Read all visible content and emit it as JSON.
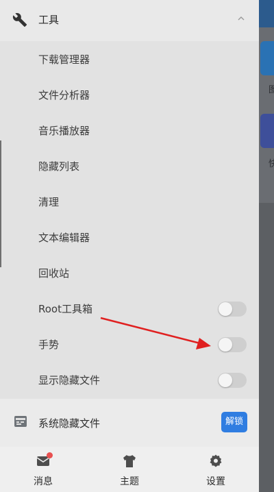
{
  "background": {
    "tile_labels": [
      "图",
      "快"
    ]
  },
  "drawer": {
    "section_title": "工具",
    "items": [
      {
        "label": "下载管理器"
      },
      {
        "label": "文件分析器"
      },
      {
        "label": "音乐播放器"
      },
      {
        "label": "隐藏列表"
      },
      {
        "label": "清理"
      },
      {
        "label": "文本编辑器"
      },
      {
        "label": "回收站"
      },
      {
        "label": "Root工具箱",
        "toggle": false
      },
      {
        "label": "手势",
        "toggle": false
      },
      {
        "label": "显示隐藏文件",
        "toggle": false
      }
    ],
    "hidden_files": {
      "label": "系统隐藏文件",
      "unlock_label": "解锁"
    }
  },
  "bottom_nav": [
    {
      "label": "消息",
      "icon": "message-icon",
      "badge": true
    },
    {
      "label": "主题",
      "icon": "shirt-icon"
    },
    {
      "label": "设置",
      "icon": "gear-icon"
    }
  ],
  "colors": {
    "accent": "#2f7de1",
    "badge": "#e85050",
    "annotation_arrow": "#e02020"
  }
}
